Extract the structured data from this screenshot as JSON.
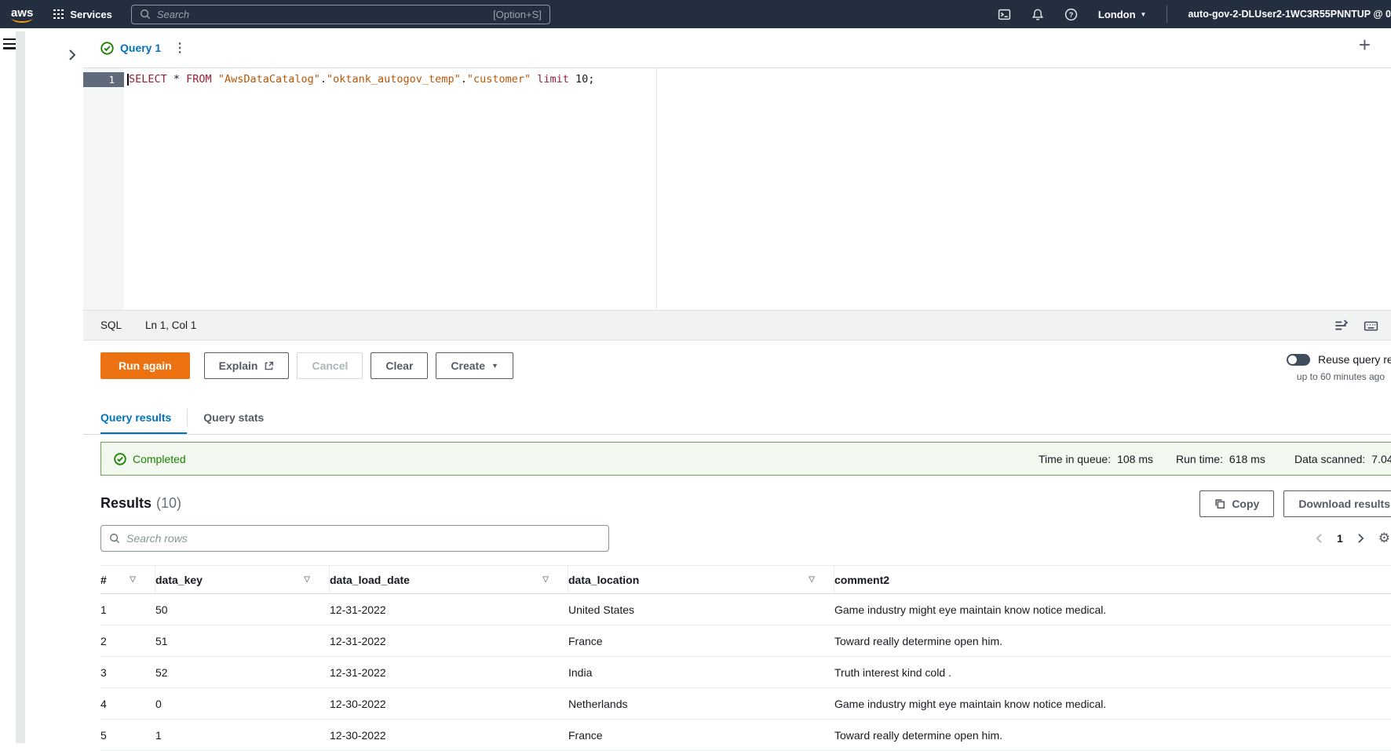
{
  "topbar": {
    "logo_text": "aws",
    "services_label": "Services",
    "search_placeholder": "Search",
    "search_shortcut": "[Option+S]",
    "region_label": "London",
    "account_label": "auto-gov-2-DLUser2-1WC3R55PNNTUP @ 0"
  },
  "query_tab": {
    "label": "Query 1"
  },
  "editor": {
    "line_number": "1",
    "sql": {
      "kw_select": "SELECT",
      "star": " * ",
      "kw_from": "FROM",
      "space": " ",
      "ident_catalog": "\"AwsDataCatalog\"",
      "dot1": ".",
      "ident_db": "\"oktank_autogov_temp\"",
      "dot2": ".",
      "ident_table": "\"customer\"",
      "kw_limit": " limit ",
      "number": "10",
      "semicolon": ";"
    },
    "status_language": "SQL",
    "status_cursor": "Ln 1, Col 1"
  },
  "actions": {
    "run_label": "Run again",
    "explain_label": "Explain",
    "cancel_label": "Cancel",
    "clear_label": "Clear",
    "create_label": "Create",
    "reuse_toggle_label": "Reuse query results",
    "reuse_toggle_sub": "up to 60 minutes ago"
  },
  "result_tabs": {
    "tab_results": "Query results",
    "tab_stats": "Query stats"
  },
  "banner": {
    "status": "Completed",
    "metrics": [
      {
        "label": "Time in queue:",
        "value": "108 ms"
      },
      {
        "label": "Run time:",
        "value": "618 ms"
      },
      {
        "label": "Data scanned:",
        "value": "7.04"
      }
    ]
  },
  "results": {
    "title": "Results",
    "count": "(10)",
    "copy_label": "Copy",
    "download_label": "Download results",
    "search_placeholder": "Search rows",
    "current_page": "1"
  },
  "table": {
    "columns": [
      "#",
      "data_key",
      "data_load_date",
      "data_location",
      "comment2"
    ],
    "rows": [
      [
        "1",
        "50",
        "12-31-2022",
        "United States",
        "Game industry might eye maintain know notice medical."
      ],
      [
        "2",
        "51",
        "12-31-2022",
        "France",
        "Toward really determine open him."
      ],
      [
        "3",
        "52",
        "12-31-2022",
        "India",
        "Truth interest kind cold ."
      ],
      [
        "4",
        "0",
        "12-30-2022",
        "Netherlands",
        "Game industry might eye maintain know notice medical."
      ],
      [
        "5",
        "1",
        "12-30-2022",
        "France",
        "Toward really determine open him."
      ]
    ]
  },
  "colors": {
    "topbar_bg": "#232f3e",
    "primary_orange": "#ec7211",
    "link_blue": "#0073bb",
    "success_green": "#1d8102"
  },
  "icons": {
    "ellipsis": "⋮",
    "plus": "+",
    "caret_down": "▼",
    "sort_triangle": "▽",
    "gear": "⚙"
  }
}
